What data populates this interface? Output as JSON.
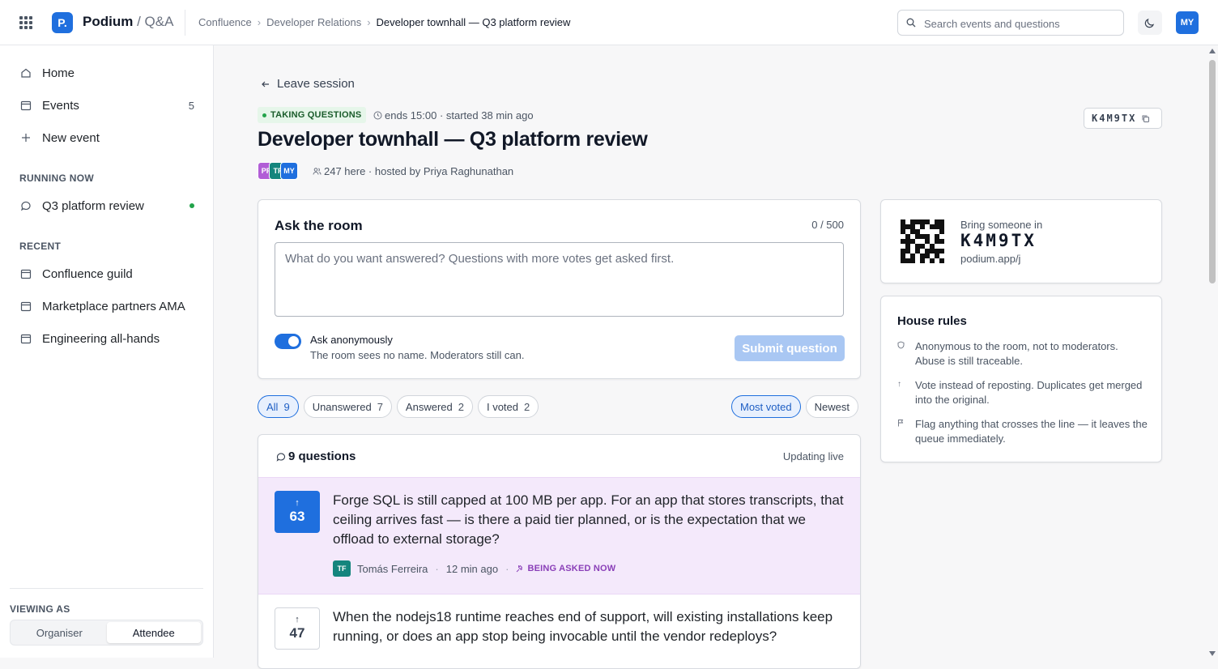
{
  "topbar": {
    "logo_letter": "P.",
    "brand": "Podium",
    "brand_sub": "/ Q&A",
    "breadcrumbs": [
      "Confluence",
      "Developer Relations",
      "Developer townhall — Q3 platform review"
    ],
    "search_placeholder": "Search events and questions",
    "user_initials": "MY"
  },
  "sidebar": {
    "nav": [
      {
        "label": "Home",
        "icon": "home-icon"
      },
      {
        "label": "Events",
        "icon": "calendar-icon",
        "count": "5"
      },
      {
        "label": "New event",
        "icon": "plus-icon"
      }
    ],
    "running_label": "RUNNING NOW",
    "running": [
      {
        "label": "Q3 platform review",
        "icon": "chat-bubble-icon"
      }
    ],
    "recent_label": "RECENT",
    "recent": [
      {
        "label": "Confluence guild"
      },
      {
        "label": "Marketplace partners AMA"
      },
      {
        "label": "Engineering all-hands"
      }
    ],
    "viewing_label": "VIEWING AS",
    "viewing_options": [
      "Organiser",
      "Attendee"
    ],
    "viewing_selected": "Attendee"
  },
  "session": {
    "leave_label": "Leave session",
    "status": "TAKING QUESTIONS",
    "timing": "ends 15:00 · started 38 min ago",
    "title": "Developer townhall — Q3 platform review",
    "code": "K4M9TX",
    "attendee_avatars": [
      {
        "initials": "PR",
        "color": "#b15ed6"
      },
      {
        "initials": "TF",
        "color": "#14857d"
      },
      {
        "initials": "MY",
        "color": "#1f6fde"
      }
    ],
    "attendance": "247 here · hosted by Priya Raghunathan"
  },
  "ask": {
    "title": "Ask the room",
    "char_count": "0 / 500",
    "placeholder": "What do you want answered? Questions with more votes get asked first.",
    "anonymous_label": "Ask anonymously",
    "anonymous_sub": "The room sees no name. Moderators still can.",
    "anonymous_on": true,
    "submit_label": "Submit question"
  },
  "filters": [
    {
      "label": "All",
      "count": "9",
      "active": true
    },
    {
      "label": "Unanswered",
      "count": "7"
    },
    {
      "label": "Answered",
      "count": "2"
    },
    {
      "label": "I voted",
      "count": "2"
    }
  ],
  "sort": [
    {
      "label": "Most voted",
      "active": true
    },
    {
      "label": "Newest"
    }
  ],
  "questions_header": "9 questions",
  "questions_status": "Updating live",
  "questions": [
    {
      "votes": "63",
      "voted": true,
      "text": "Forge SQL is still capped at 100 MB per app. For an app that stores transcripts, that ceiling arrives fast — is there a paid tier planned, or is the expectation that we offload to external storage?",
      "author_initials": "TF",
      "author": "Tomás Ferreira",
      "time": "12 min ago",
      "badge": "BEING ASKED NOW"
    },
    {
      "votes": "47",
      "voted": false,
      "text": "When the nodejs18 runtime reaches end of support, will existing installations keep running, or does an app stop being invocable until the vendor redeploys?"
    }
  ],
  "invite": {
    "label": "Bring someone in",
    "code": "K4M9TX",
    "url": "podium.app/j"
  },
  "rules": {
    "title": "House rules",
    "items": [
      {
        "icon": "shield-icon",
        "text": "Anonymous to the room, not to moderators. Abuse is still traceable."
      },
      {
        "icon": "arrow-up-icon",
        "text": "Vote instead of reposting. Duplicates get merged into the original."
      },
      {
        "icon": "flag-icon",
        "text": "Flag anything that crosses the line — it leaves the queue immediately."
      }
    ]
  },
  "colors": {
    "accent": "#1f6fde",
    "live_green": "#22a34a",
    "asking_now_bg": "#f4e9fb",
    "asking_now_text": "#8a3fb8"
  }
}
